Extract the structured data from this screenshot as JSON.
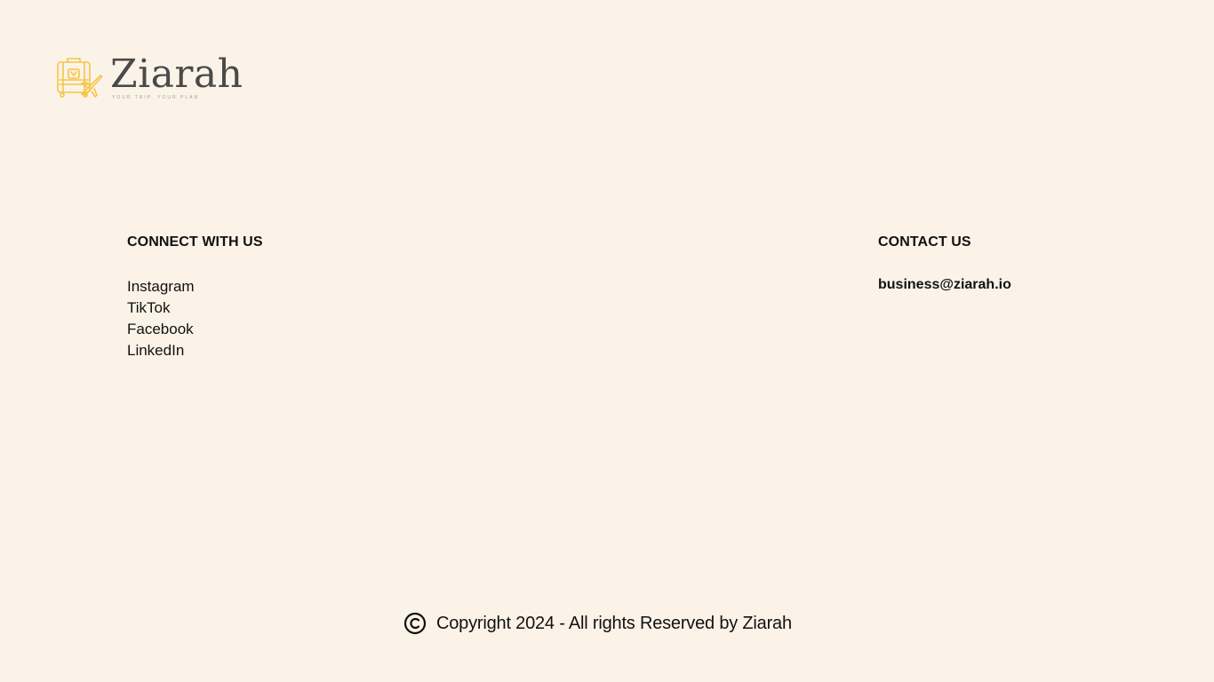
{
  "brand": {
    "name": "Ziarah",
    "tagline": "YOUR TRIP. YOUR PLAN",
    "logo_icon": "suitcase-plane-icon",
    "logo_color": "#f5c542",
    "text_color": "#4a4a4a"
  },
  "connect": {
    "heading": "CONNECT WITH US",
    "links": [
      {
        "label": "Instagram"
      },
      {
        "label": "TikTok"
      },
      {
        "label": "Facebook"
      },
      {
        "label": "LinkedIn"
      }
    ]
  },
  "contact": {
    "heading": "CONTACT US",
    "email": "business@ziarah.io"
  },
  "footer": {
    "icon": "copyright-icon",
    "text": "Copyright 2024 - All rights Reserved by Ziarah"
  },
  "colors": {
    "background": "#fcf3e8",
    "text": "#111111"
  }
}
